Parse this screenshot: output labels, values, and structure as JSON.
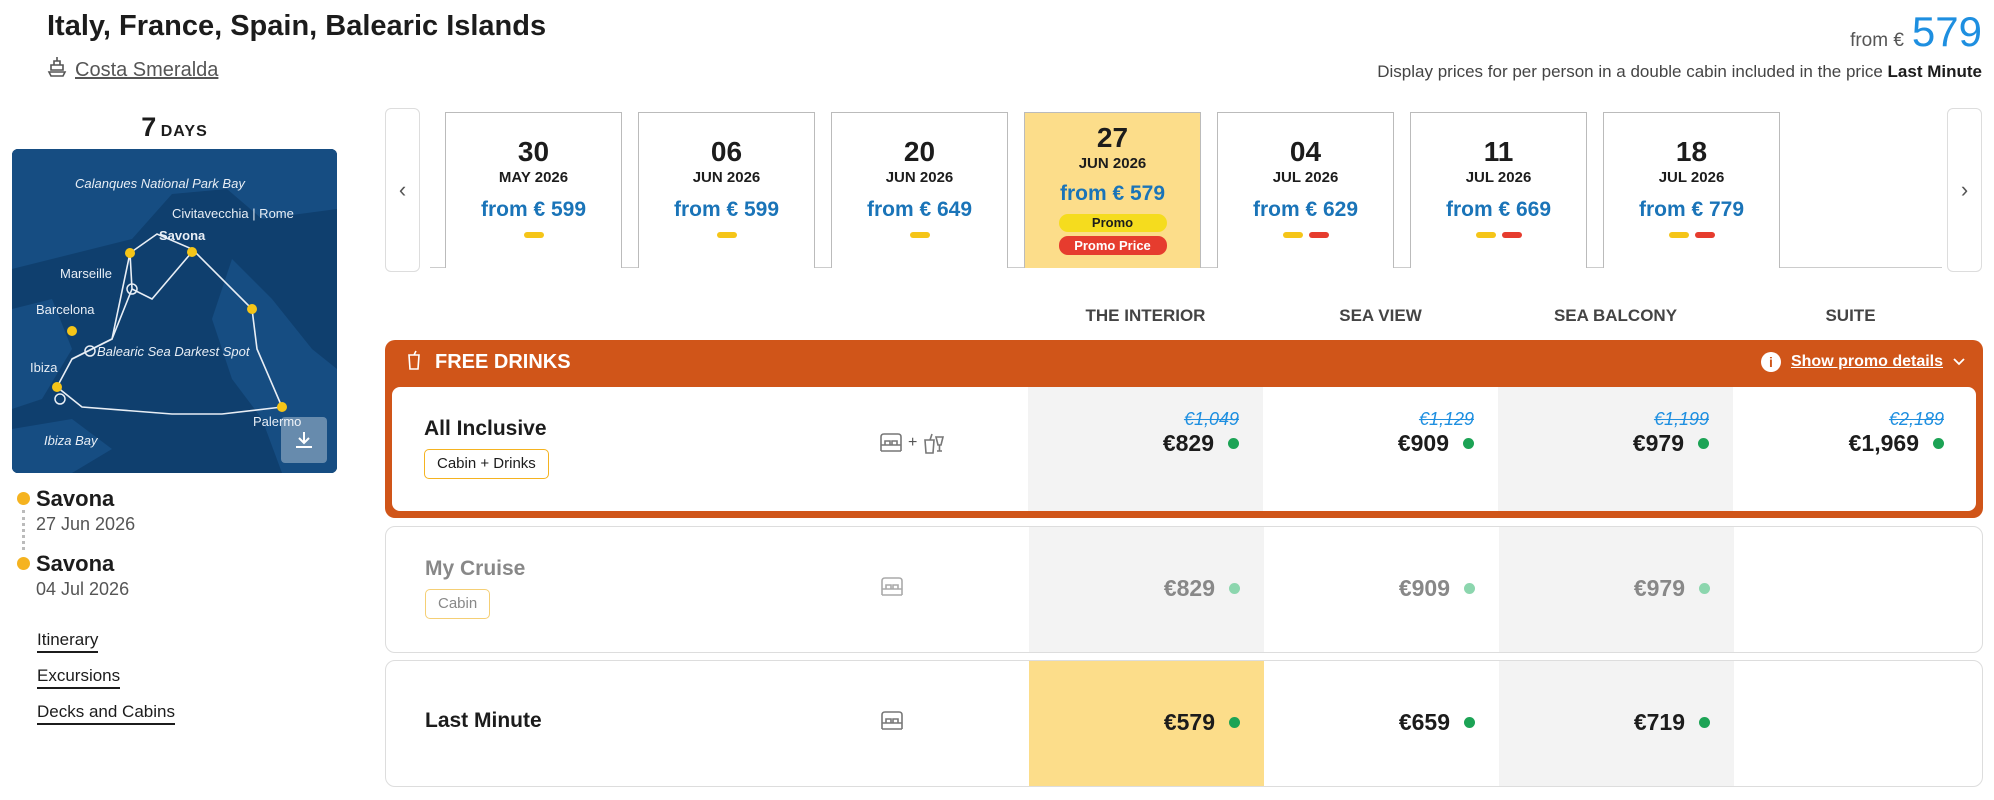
{
  "header": {
    "title": "Italy, France, Spain, Balearic Islands",
    "ship": "Costa Smeralda",
    "price_from": "from €",
    "price_amount": "579",
    "price_note": "Display prices for per person in a double cabin included in the price",
    "price_note_bold": "Last Minute"
  },
  "sidebar": {
    "days_num": "7",
    "days_label": "DAYS",
    "map_labels": {
      "calanques": "Calanques National Park Bay",
      "civitavecchia": "Civitavecchia | Rome",
      "savona": "Savona",
      "marseille": "Marseille",
      "barcelona": "Barcelona",
      "balearic": "Balearic Sea Darkest Spot",
      "ibiza": "Ibiza",
      "ibiza_bay": "Ibiza Bay",
      "palermo": "Palermo"
    },
    "departure": {
      "port": "Savona",
      "date": "27 Jun 2026"
    },
    "arrival": {
      "port": "Savona",
      "date": "04 Jul 2026"
    },
    "links": [
      "Itinerary",
      "Excursions",
      "Decks and Cabins"
    ]
  },
  "dates": [
    {
      "day": "30",
      "month": "MAY 2026",
      "price": "from € 599",
      "marks": [
        "y"
      ]
    },
    {
      "day": "06",
      "month": "JUN 2026",
      "price": "from € 599",
      "marks": [
        "y"
      ]
    },
    {
      "day": "20",
      "month": "JUN 2026",
      "price": "from € 649",
      "marks": [
        "y"
      ]
    },
    {
      "day": "27",
      "month": "JUN 2026",
      "price": "from € 579",
      "badges": [
        "Promo",
        "Promo Price"
      ],
      "selected": true
    },
    {
      "day": "04",
      "month": "JUL 2026",
      "price": "from € 629",
      "marks": [
        "y",
        "r"
      ]
    },
    {
      "day": "11",
      "month": "JUL 2026",
      "price": "from € 669",
      "marks": [
        "y",
        "r"
      ]
    },
    {
      "day": "18",
      "month": "JUL 2026",
      "price": "from € 779",
      "marks": [
        "y",
        "r"
      ]
    }
  ],
  "columns": [
    "THE INTERIOR",
    "SEA VIEW",
    "SEA BALCONY",
    "SUITE"
  ],
  "promo": {
    "title": "FREE DRINKS",
    "details_link": "Show promo details"
  },
  "rows": [
    {
      "name": "All Inclusive",
      "tag": "Cabin + Drinks",
      "icon_sep": "+",
      "prices": [
        {
          "old": "€1,049",
          "now": "€829"
        },
        {
          "old": "€1,129",
          "now": "€909"
        },
        {
          "old": "€1,199",
          "now": "€979"
        },
        {
          "old": "€2,189",
          "now": "€1,969"
        }
      ]
    },
    {
      "name": "My Cruise",
      "tag": "Cabin",
      "prices": [
        {
          "now": "€829"
        },
        {
          "now": "€909"
        },
        {
          "now": "€979"
        }
      ]
    },
    {
      "name": "Last Minute",
      "prices": [
        {
          "now": "€579"
        },
        {
          "now": "€659"
        },
        {
          "now": "€719"
        }
      ]
    }
  ],
  "colors": {
    "accent_orange": "#d05519",
    "price_blue": "#1e8fe0",
    "selected_yellow": "#fcdd8a",
    "available_green": "#1ca355",
    "promo_red": "#e63c2e"
  }
}
